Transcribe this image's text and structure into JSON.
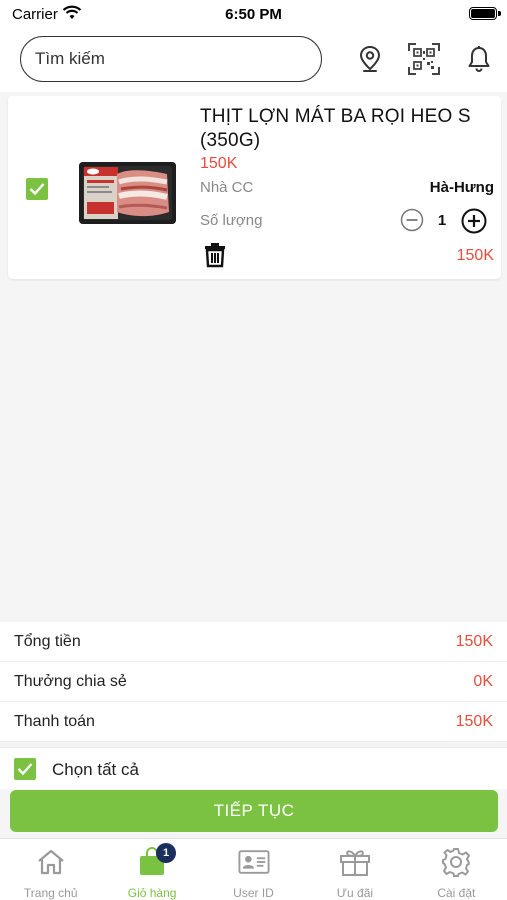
{
  "status_bar": {
    "carrier": "Carrier",
    "time": "6:50 PM"
  },
  "header": {
    "search_placeholder": "Tìm kiếm",
    "icons": [
      "location-pin-icon",
      "qr-code-icon",
      "bell-icon"
    ]
  },
  "cart_item": {
    "checked": true,
    "name": "THỊT LỢN MÁT BA RỌI HEO S (350G)",
    "price": "150K",
    "supplier_label": "Nhà CC",
    "supplier_value": "Hà-Hưng",
    "quantity_label": "Số lượng",
    "quantity": "1",
    "line_total": "150K"
  },
  "summary": {
    "rows": [
      {
        "label": "Tổng tiền",
        "value": "150K"
      },
      {
        "label": "Thưởng chia sẻ",
        "value": "0K"
      },
      {
        "label": "Thanh toán",
        "value": "150K"
      }
    ]
  },
  "select_all": {
    "label": "Chọn tất cả",
    "checked": true
  },
  "continue_label": "TIẾP TỤC",
  "tabbar": {
    "items": [
      {
        "label": "Trang chủ",
        "icon": "home-icon",
        "active": false
      },
      {
        "label": "Giỏ hàng",
        "icon": "cart-icon",
        "active": true,
        "badge": "1"
      },
      {
        "label": "User ID",
        "icon": "id-card-icon",
        "active": false
      },
      {
        "label": "Ưu đãi",
        "icon": "gift-icon",
        "active": false
      },
      {
        "label": "Cài đặt",
        "icon": "gear-icon",
        "active": false
      }
    ]
  },
  "colors": {
    "accent": "#7cc242",
    "price": "#e74c3c",
    "badge": "#1b2e5c"
  }
}
